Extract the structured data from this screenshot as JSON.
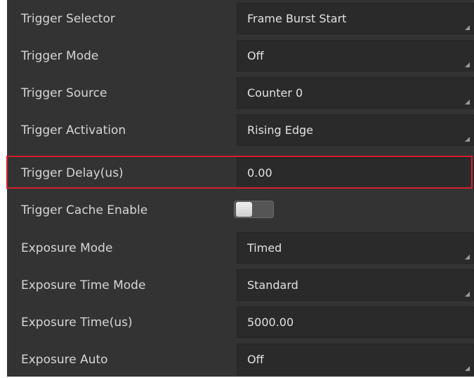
{
  "rows": [
    {
      "label": "Trigger Selector",
      "value": "Frame Burst Start",
      "type": "select"
    },
    {
      "label": "Trigger Mode",
      "value": "Off",
      "type": "select"
    },
    {
      "label": "Trigger Source",
      "value": "Counter 0",
      "type": "select"
    },
    {
      "label": "Trigger Activation",
      "value": "Rising Edge",
      "type": "select"
    },
    {
      "label": "Trigger Delay(us)",
      "value": "0.00",
      "type": "input"
    },
    {
      "label": "Trigger Cache Enable",
      "value": null,
      "type": "toggle",
      "checked": false
    },
    {
      "label": "Exposure Mode",
      "value": "Timed",
      "type": "select"
    },
    {
      "label": "Exposure Time Mode",
      "value": "Standard",
      "type": "select"
    },
    {
      "label": "Exposure Time(us)",
      "value": "5000.00",
      "type": "input"
    },
    {
      "label": "Exposure Auto",
      "value": "Off",
      "type": "select"
    }
  ],
  "highlight_color": "#d4202a"
}
